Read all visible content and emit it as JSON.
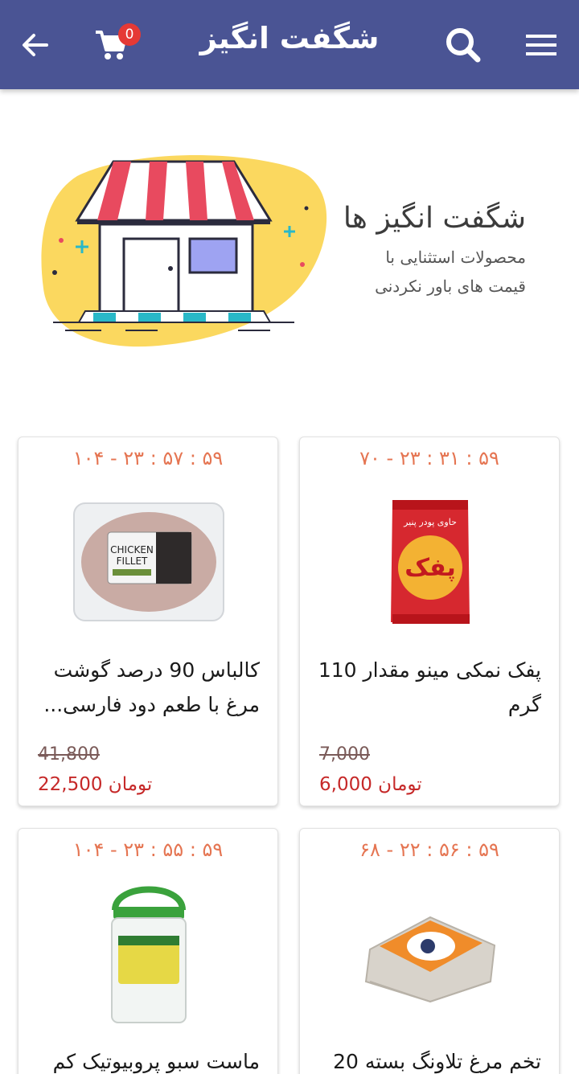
{
  "appbar": {
    "title": "شگفت انگیز",
    "cart_count": "0",
    "icons": [
      "back-arrow-icon",
      "cart-icon",
      "search-icon",
      "menu-icon"
    ]
  },
  "banner": {
    "title": "شگفت انگیز ها",
    "line1": "محصولات استثنایی با",
    "line2": "قیمت های باور نکردنی"
  },
  "colors": {
    "appbar": "#4a5494",
    "timer": "#e57552",
    "price": "#c62828"
  },
  "products": [
    {
      "timer": "۱۰۴ - ۲۳ : ۵۷ : ۵۹",
      "name": "کالباس 90 درصد گوشت مرغ با طعم دود فارسی...",
      "old_price": "41,800",
      "price": "22,500",
      "currency": "تومان",
      "image_icon": "chicken-fillet-image"
    },
    {
      "timer": "۷۰ - ۲۳ : ۳۱ : ۵۹",
      "name": "پفک نمکی مینو مقدار 110 گرم",
      "old_price": "7,000",
      "price": "6,000",
      "currency": "تومان",
      "image_icon": "puffs-bag-image"
    },
    {
      "timer": "۱۰۴ - ۲۳ : ۵۵ : ۵۹",
      "name": "ماست سبو پروبیوتیک کم",
      "old_price": "",
      "price": "",
      "currency": "",
      "image_icon": "yogurt-jug-image"
    },
    {
      "timer": "۶۸ - ۲۲ : ۵۶ : ۵۹",
      "name": "تخم مرغ تلاونگ بسته 20",
      "old_price": "",
      "price": "",
      "currency": "",
      "image_icon": "egg-tray-image"
    }
  ]
}
